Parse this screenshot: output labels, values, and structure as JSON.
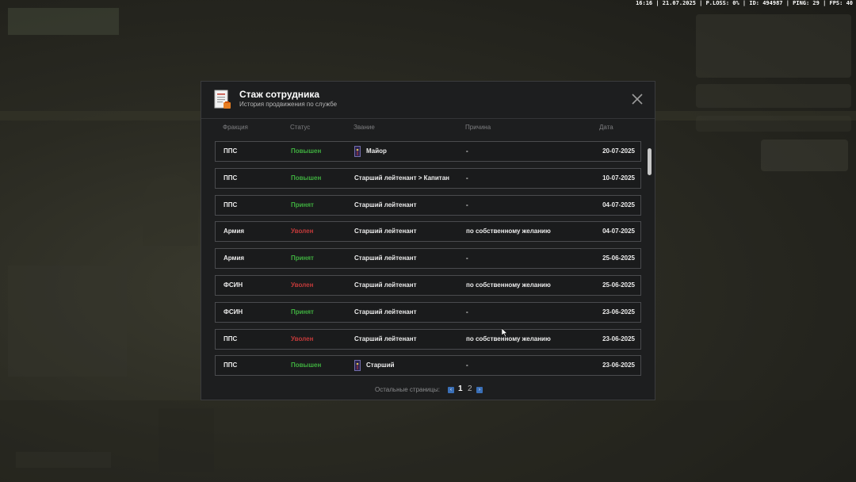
{
  "hud": {
    "text": "16:16 | 21.07.2025 | P.LOSS: 0% | ID: 494987 | PING: 29 | FPS: 40"
  },
  "modal": {
    "title": "Стаж сотрудника",
    "subtitle": "История продвижения по службе",
    "icon": "document-icon",
    "close_icon": "close-icon"
  },
  "columns": {
    "faction": "Фракция",
    "status": "Статус",
    "rank": "Звание",
    "reason": "Причина",
    "date": "Дата"
  },
  "colors": {
    "promoted": "#3fae3f",
    "accepted": "#3fae3f",
    "dismissed": "#c23a3a",
    "accent": "#3a6fb7"
  },
  "rows": [
    {
      "faction": "ППС",
      "status": "Повышен",
      "status_type": "promoted",
      "rank": "Майор",
      "rank_icon": true,
      "reason": "-",
      "date": "20-07-2025"
    },
    {
      "faction": "ППС",
      "status": "Повышен",
      "status_type": "promoted",
      "rank": "Старший лейтенант > Капитан",
      "rank_icon": false,
      "reason": "-",
      "date": "10-07-2025"
    },
    {
      "faction": "ППС",
      "status": "Принят",
      "status_type": "accepted",
      "rank": "Старший лейтенант",
      "rank_icon": false,
      "reason": "-",
      "date": "04-07-2025"
    },
    {
      "faction": "Армия",
      "status": "Уволен",
      "status_type": "dismissed",
      "rank": "Старший лейтенант",
      "rank_icon": false,
      "reason": "по собственному желанию",
      "date": "04-07-2025"
    },
    {
      "faction": "Армия",
      "status": "Принят",
      "status_type": "accepted",
      "rank": "Старший лейтенант",
      "rank_icon": false,
      "reason": "-",
      "date": "25-06-2025"
    },
    {
      "faction": "ФСИН",
      "status": "Уволен",
      "status_type": "dismissed",
      "rank": "Старший лейтенант",
      "rank_icon": false,
      "reason": "по собственному желанию",
      "date": "25-06-2025"
    },
    {
      "faction": "ФСИН",
      "status": "Принят",
      "status_type": "accepted",
      "rank": "Старший лейтенант",
      "rank_icon": false,
      "reason": "-",
      "date": "23-06-2025"
    },
    {
      "faction": "ППС",
      "status": "Уволен",
      "status_type": "dismissed",
      "rank": "Старший лейтенант",
      "rank_icon": false,
      "reason": "по собственному желанию",
      "date": "23-06-2025"
    },
    {
      "faction": "ППС",
      "status": "Повышен",
      "status_type": "promoted",
      "rank": "Старший",
      "rank_icon": true,
      "reason": "-",
      "date": "23-06-2025"
    }
  ],
  "pagination": {
    "label": "Остальные страницы:",
    "prev_icon": "chevron-left-icon",
    "next_icon": "chevron-right-icon",
    "pages": [
      "1",
      "2"
    ],
    "current": "1"
  }
}
